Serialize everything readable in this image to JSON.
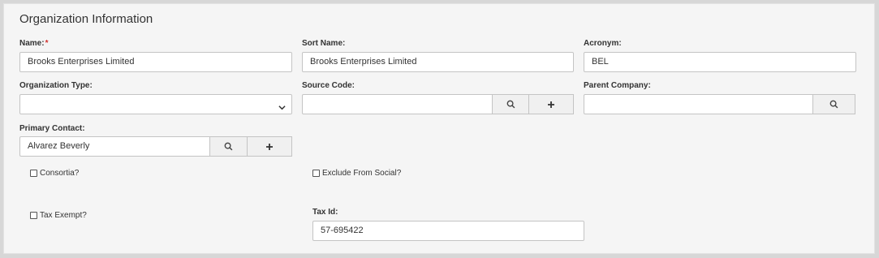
{
  "section_title": "Organization Information",
  "fields": {
    "name": {
      "label": "Name:",
      "required_mark": "*",
      "value": "Brooks Enterprises Limited"
    },
    "sort_name": {
      "label": "Sort Name:",
      "value": "Brooks Enterprises Limited"
    },
    "acronym": {
      "label": "Acronym:",
      "value": "BEL"
    },
    "organization_type": {
      "label": "Organization Type:",
      "value": ""
    },
    "source_code": {
      "label": "Source Code:",
      "value": ""
    },
    "parent_company": {
      "label": "Parent Company:",
      "value": ""
    },
    "primary_contact": {
      "label": "Primary Contact:",
      "value": "Alvarez Beverly"
    },
    "tax_id": {
      "label": "Tax Id:",
      "value": "57-695422"
    }
  },
  "checkboxes": {
    "consortia": {
      "label": "Consortia?",
      "checked": false
    },
    "exclude_from_social": {
      "label": "Exclude From Social?",
      "checked": false
    },
    "tax_exempt": {
      "label": "Tax Exempt?",
      "checked": false
    }
  },
  "icons": {
    "search": "search-icon",
    "add": "plus-icon",
    "dropdown": "chevron-down-icon"
  },
  "colors": {
    "required": "#d0312d",
    "panel_bg": "#f5f5f5",
    "page_bg": "#d7d7d7"
  }
}
